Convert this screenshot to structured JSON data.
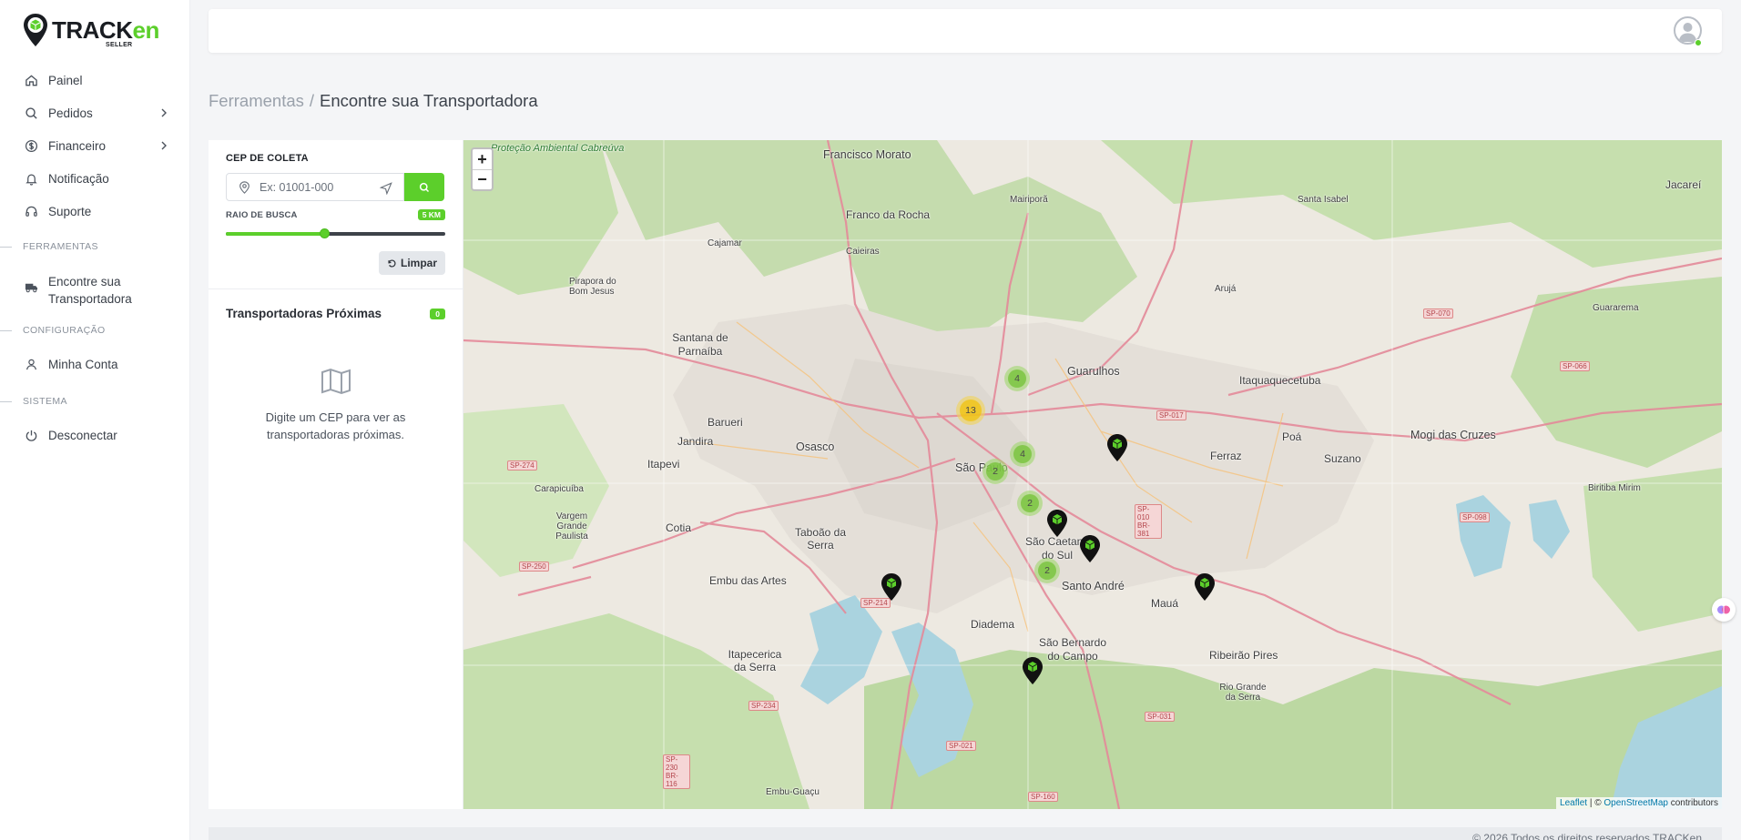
{
  "brand": {
    "name_main": "TRACK",
    "name_accent": "en",
    "subtitle": "SELLER"
  },
  "sidebar": {
    "items": [
      {
        "label": "Painel",
        "icon": "home-icon"
      },
      {
        "label": "Pedidos",
        "icon": "search-icon",
        "has_submenu": true
      },
      {
        "label": "Financeiro",
        "icon": "dollar-icon",
        "has_submenu": true
      },
      {
        "label": "Notificação",
        "icon": "bell-icon"
      },
      {
        "label": "Suporte",
        "icon": "headset-icon"
      }
    ],
    "sections": [
      {
        "title": "FERRAMENTAS",
        "items": [
          {
            "label": "Encontre sua Transportadora",
            "icon": "truck-icon"
          }
        ]
      },
      {
        "title": "CONFIGURAÇÃO",
        "items": [
          {
            "label": "Minha Conta",
            "icon": "user-icon"
          }
        ]
      },
      {
        "title": "SISTEMA",
        "items": [
          {
            "label": "Desconectar",
            "icon": "power-icon"
          }
        ]
      }
    ]
  },
  "breadcrumb": {
    "parent": "Ferramentas",
    "separator": "/",
    "current": "Encontre sua Transportadora"
  },
  "search_panel": {
    "cep_label": "CEP DE COLETA",
    "cep_placeholder": "Ex: 01001-000",
    "cep_value": "",
    "radius_label": "RAIO DE BUSCA",
    "radius_value": "5 KM",
    "radius_fraction": 0.45,
    "clear_label": "Limpar"
  },
  "results": {
    "title": "Transportadoras Próximas",
    "count": "0",
    "empty_message": "Digite um CEP para ver as transportadoras próximas."
  },
  "map": {
    "zoom_in": "+",
    "zoom_out": "−",
    "attribution": {
      "leaflet": "Leaflet",
      "sep": " | © ",
      "osm": "OpenStreetMap",
      "suffix": " contributors"
    },
    "clusters": [
      {
        "count": "4",
        "color": "green"
      },
      {
        "count": "13",
        "color": "yellow"
      },
      {
        "count": "4",
        "color": "green"
      },
      {
        "count": "2",
        "color": "green"
      },
      {
        "count": "2",
        "color": "green"
      },
      {
        "count": "2",
        "color": "green"
      }
    ],
    "place_labels": [
      "Francisco Morato",
      "Franco da Rocha",
      "Mairiporã",
      "Caieiras",
      "Cajamar",
      "Pirapora do Bom Jesus",
      "Santana de Parnaíba",
      "Barueri",
      "Jandira",
      "Osasco",
      "Itapevi",
      "Carapicuíba",
      "Cotia",
      "Vargem Grande Paulista",
      "Taboão da Serra",
      "Embu das Artes",
      "Itapecerica da Serra",
      "Embu-Guaçu",
      "São Paulo",
      "Guarulhos",
      "Arujá",
      "Santa Isabel",
      "Jacareí",
      "Guararema",
      "Itaquaquecetuba",
      "Poá",
      "Suzano",
      "Ferraz",
      "Mogi das Cruzes",
      "Biritiba Mirim",
      "São Caetano do Sul",
      "Santo André",
      "Mauá",
      "Ribeirão Pires",
      "Rio Grande da Serra",
      "Diadema",
      "São Bernardo do Campo",
      "Proteção Ambiental Cabreúva"
    ],
    "road_shields": [
      "SP-274",
      "SP-250",
      "SP-214",
      "SP-234",
      "SP-230 BR-116",
      "SP-021",
      "SP-160",
      "SP-031",
      "SP-017",
      "SP-010 BR-381",
      "SP-070",
      "SP-066",
      "SP-098"
    ]
  },
  "footer": {
    "text": "© 2026 Todos os direitos reservados TRACKen"
  },
  "colors": {
    "accent": "#5ccf2b",
    "text": "#2b2f36",
    "muted": "#9aa1ab"
  }
}
